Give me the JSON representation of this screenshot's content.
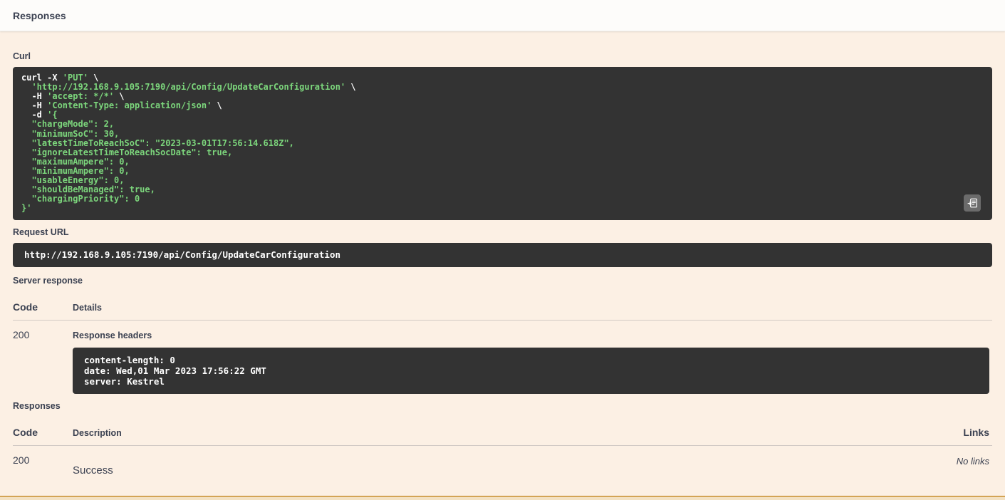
{
  "colors": {
    "section_bg": "#fcf0e4",
    "code_block_bg": "#333333",
    "code_string_green": "#7cd67c",
    "text": "#3b4151",
    "put_accent_border": "#d3a455"
  },
  "header": {
    "title": "Responses"
  },
  "curl": {
    "label": "Curl",
    "copy_icon": "clipboard-icon",
    "lines": [
      [
        {
          "c": "cmd",
          "t": "curl"
        },
        {
          "c": "plain",
          "t": " -X "
        },
        {
          "c": "str",
          "t": "'PUT'"
        },
        {
          "c": "plain",
          "t": " \\"
        }
      ],
      [
        {
          "c": "str",
          "t": "  'http://192.168.9.105:7190/api/Config/UpdateCarConfiguration'"
        },
        {
          "c": "plain",
          "t": " \\"
        }
      ],
      [
        {
          "c": "plain",
          "t": "  -H "
        },
        {
          "c": "str",
          "t": "'accept: */*'"
        },
        {
          "c": "plain",
          "t": " \\"
        }
      ],
      [
        {
          "c": "plain",
          "t": "  -H "
        },
        {
          "c": "str",
          "t": "'Content-Type: application/json'"
        },
        {
          "c": "plain",
          "t": " \\"
        }
      ],
      [
        {
          "c": "plain",
          "t": "  -d "
        },
        {
          "c": "str",
          "t": "'{"
        }
      ],
      [
        {
          "c": "str",
          "t": "  \"chargeMode\": 2,"
        }
      ],
      [
        {
          "c": "str",
          "t": "  \"minimumSoC\": 30,"
        }
      ],
      [
        {
          "c": "str",
          "t": "  \"latestTimeToReachSoC\": \"2023-03-01T17:56:14.618Z\","
        }
      ],
      [
        {
          "c": "str",
          "t": "  \"ignoreLatestTimeToReachSocDate\": true,"
        }
      ],
      [
        {
          "c": "str",
          "t": "  \"maximumAmpere\": 0,"
        }
      ],
      [
        {
          "c": "str",
          "t": "  \"minimumAmpere\": 0,"
        }
      ],
      [
        {
          "c": "str",
          "t": "  \"usableEnergy\": 0,"
        }
      ],
      [
        {
          "c": "str",
          "t": "  \"shouldBeManaged\": true,"
        }
      ],
      [
        {
          "c": "str",
          "t": "  \"chargingPriority\": 0"
        }
      ],
      [
        {
          "c": "str",
          "t": "}'"
        }
      ]
    ]
  },
  "request_url": {
    "label": "Request URL",
    "value": "http://192.168.9.105:7190/api/Config/UpdateCarConfiguration"
  },
  "server_response": {
    "label": "Server response",
    "columns": {
      "code": "Code",
      "details": "Details"
    },
    "row": {
      "code": "200",
      "headers_label": "Response headers",
      "headers": [
        "content-length: 0",
        "date: Wed,01 Mar 2023 17:56:22 GMT",
        "server: Kestrel"
      ]
    }
  },
  "responses_table": {
    "label": "Responses",
    "columns": {
      "code": "Code",
      "description": "Description",
      "links": "Links"
    },
    "row": {
      "code": "200",
      "description": "Success",
      "links": "No links"
    }
  }
}
